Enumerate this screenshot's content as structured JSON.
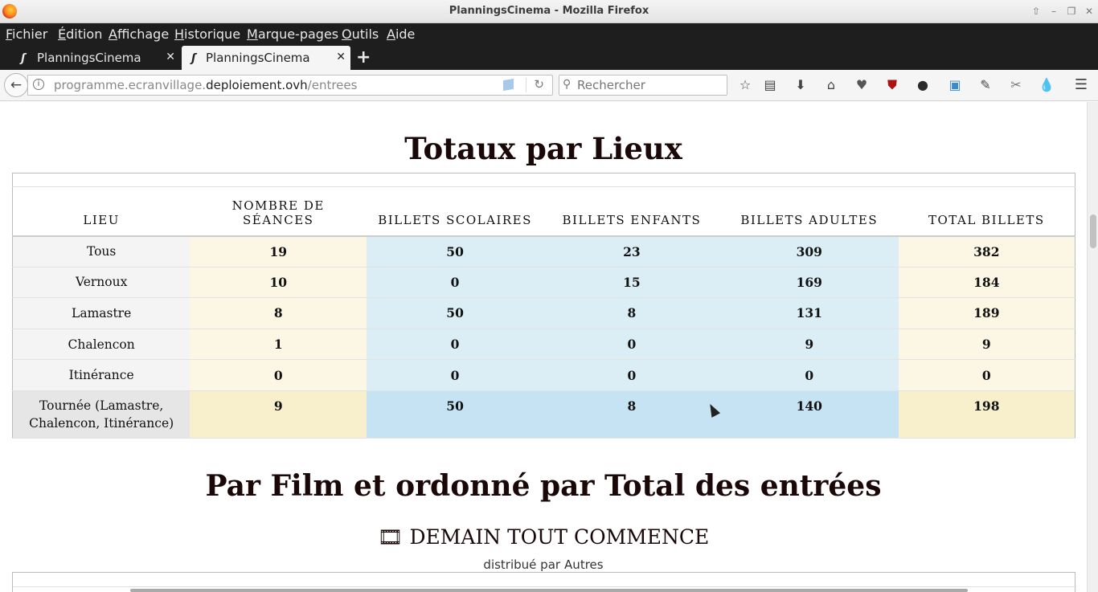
{
  "window": {
    "title": "PlanningsCinema - Mozilla Firefox"
  },
  "menu": {
    "items": [
      {
        "u": "F",
        "rest": "ichier"
      },
      {
        "u": "É",
        "rest": "dition"
      },
      {
        "u": "A",
        "rest": "ffichage"
      },
      {
        "u": "H",
        "rest": "istorique"
      },
      {
        "u": "M",
        "rest": "arque-pages"
      },
      {
        "u": "O",
        "rest": "utils"
      },
      {
        "u": "A",
        "rest": "ide"
      }
    ]
  },
  "tabs": [
    {
      "label": "PlanningsCinema",
      "active": false
    },
    {
      "label": "PlanningsCinema",
      "active": true
    }
  ],
  "nav": {
    "url_prefix": "programme.ecranvillage.",
    "url_host": "deploiement.ovh",
    "url_path": "/entrees",
    "search_placeholder": "Rechercher"
  },
  "page": {
    "section1_title": "Totaux par Lieux",
    "section2_title": "Par Film et ordonné par Total des entrées",
    "movie_title": "DEMAIN TOUT COMMENCE",
    "movie_icon": "film-icon",
    "distrib_label": "distribué par",
    "distrib_value": "Autres"
  },
  "table": {
    "headers": [
      "Lieu",
      "Nombre de séances",
      "Billets scolaires",
      "Billets enfants",
      "Billets adultes",
      "Total billets"
    ],
    "rows": [
      [
        "Tous",
        "19",
        "50",
        "23",
        "309",
        "382"
      ],
      [
        "Vernoux",
        "10",
        "0",
        "15",
        "169",
        "184"
      ],
      [
        "Lamastre",
        "8",
        "50",
        "8",
        "131",
        "189"
      ],
      [
        "Chalencon",
        "1",
        "0",
        "0",
        "9",
        "9"
      ],
      [
        "Itinérance",
        "0",
        "0",
        "0",
        "0",
        "0"
      ]
    ],
    "tournee": [
      "Tournée (Lamastre, Chalencon, Itinérance)",
      "9",
      "50",
      "8",
      "140",
      "198"
    ]
  },
  "colors": {
    "seances_bg": "#fcf6e4",
    "billets_bg": "#dbeef6",
    "heading": "#1a0808"
  }
}
